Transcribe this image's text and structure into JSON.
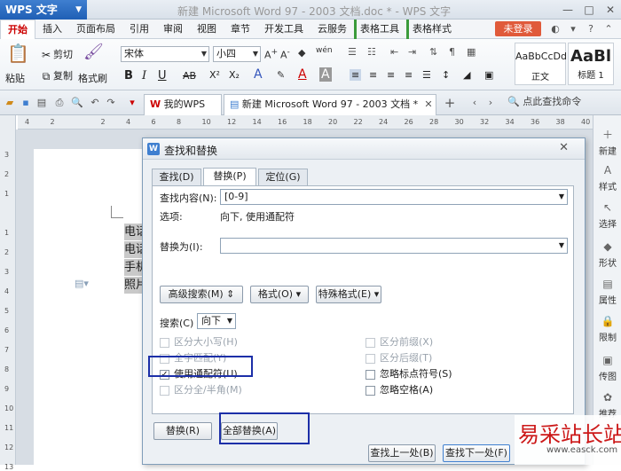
{
  "app": {
    "name": "WPS 文字",
    "doc_title": "新建 Microsoft Word 97 - 2003 文档.doc * - WPS 文字"
  },
  "window_controls": [
    "—",
    "□",
    "✕"
  ],
  "menu": {
    "items": [
      "开始",
      "插入",
      "页面布局",
      "引用",
      "审阅",
      "视图",
      "章节",
      "开发工具",
      "云服务",
      "表格工具",
      "表格样式"
    ],
    "login": "未登录"
  },
  "ribbon": {
    "paste": "粘贴",
    "cut": "剪切",
    "copy": "复制",
    "format_painter": "格式刷",
    "font": "宋体",
    "size": "小四",
    "style1_preview": "AaBbCcDd",
    "style1_name": "正文",
    "style2_preview": "AaBl",
    "style2_name": "标题 1"
  },
  "tabs": {
    "mywps": "我的WPS",
    "doc": "新建 Microsoft Word 97 - 2003 文档 *",
    "add": "+",
    "search_cmd": "点此查找命令"
  },
  "ruler": {
    "h": [
      "4",
      "2",
      "",
      "2",
      "4",
      "6",
      "8",
      "10",
      "12",
      "14",
      "16",
      "18",
      "20",
      "22",
      "24",
      "26",
      "28",
      "30",
      "32",
      "34",
      "36",
      "38",
      "40"
    ],
    "v": [
      "3",
      "2",
      "1",
      "",
      "1",
      "2",
      "3",
      "4",
      "5",
      "6",
      "7",
      "8",
      "9",
      "10",
      "11",
      "12",
      "13"
    ]
  },
  "document": {
    "lines": [
      "电话",
      "电话",
      "手机",
      "照片"
    ]
  },
  "sidebar": [
    "新建",
    "样式",
    "选择",
    "形状",
    "属性",
    "限制",
    "传图",
    "推荐"
  ],
  "dialog": {
    "title": "查找和替换",
    "tabs": [
      "查找(D)",
      "替换(P)",
      "定位(G)"
    ],
    "find_label": "查找内容(N):",
    "find_value": "[0-9]",
    "options_label": "选项:",
    "options_value": "向下, 使用通配符",
    "replace_label": "替换为(I):",
    "replace_value": "",
    "advanced_btn": "高级搜索(M) ⇕",
    "format_btn": "格式(O) ▾",
    "special_btn": "特殊格式(E) ▾",
    "search_label": "搜索(C)",
    "search_dir": "向下",
    "checks_left": [
      {
        "label": "区分大小写(H)",
        "checked": false,
        "disabled": true
      },
      {
        "label": "全字匹配(Y)",
        "checked": false,
        "disabled": true
      },
      {
        "label": "使用通配符(U)",
        "checked": true,
        "disabled": false
      },
      {
        "label": "区分全/半角(M)",
        "checked": false,
        "disabled": true
      }
    ],
    "checks_right": [
      {
        "label": "区分前缀(X)",
        "checked": false,
        "disabled": true
      },
      {
        "label": "区分后缀(T)",
        "checked": false,
        "disabled": true
      },
      {
        "label": "忽略标点符号(S)",
        "checked": false,
        "disabled": false
      },
      {
        "label": "忽略空格(A)",
        "checked": false,
        "disabled": false
      }
    ],
    "replace_btn": "替换(R)",
    "replace_all_btn": "全部替换(A)",
    "find_prev_btn": "查找上一处(B)",
    "find_next_btn": "查找下一处(F)"
  },
  "watermark": {
    "text": "易采站长站",
    "url": "www.easck.com"
  },
  "colors": {
    "accent": "#3f7fd0",
    "highlight": "#1c2fa8",
    "login": "#e05a3a",
    "watermark": "#cc1818"
  }
}
